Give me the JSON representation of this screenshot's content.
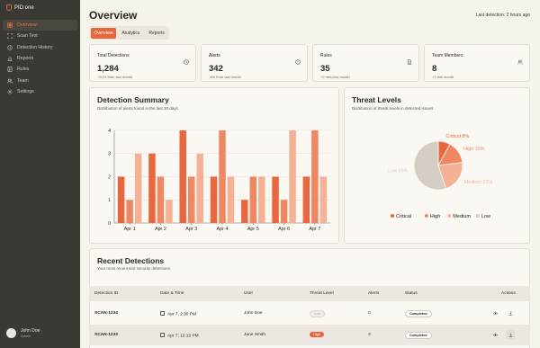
{
  "app": {
    "brand": "PID:one"
  },
  "sidebar": {
    "items": [
      {
        "label": "Overview",
        "icon": "dashboard-icon",
        "active": true
      },
      {
        "label": "Scan Text",
        "icon": "scan-icon",
        "active": false
      },
      {
        "label": "Detection History",
        "icon": "history-icon",
        "active": false
      },
      {
        "label": "Reports",
        "icon": "bar-chart-icon",
        "active": false
      },
      {
        "label": "Rules",
        "icon": "list-icon",
        "active": false
      },
      {
        "label": "Team",
        "icon": "team-icon",
        "active": false
      },
      {
        "label": "Settings",
        "icon": "gear-icon",
        "active": false
      }
    ],
    "user": {
      "name": "John Doe",
      "role": "Admin"
    }
  },
  "header": {
    "title": "Overview",
    "last_detection": "Last detection: 2 hours ago",
    "tabs": [
      "Overview",
      "Analytics",
      "Reports"
    ],
    "active_tab": "Overview"
  },
  "stats": [
    {
      "label": "Total Detections",
      "value": "1,284",
      "sub": "+10% from last month",
      "icon": "clock-icon"
    },
    {
      "label": "Alerts",
      "value": "342",
      "sub": "-4% from last month",
      "icon": "alert-icon"
    },
    {
      "label": "Rules",
      "value": "35",
      "sub": "+2 new this month",
      "icon": "document-icon"
    },
    {
      "label": "Team Members",
      "value": "8",
      "sub": "+1 this month",
      "icon": "users-icon"
    }
  ],
  "detection_summary": {
    "title": "Detection Summary",
    "subtitle": "Distribution of alerts found in the last 30 days"
  },
  "threat_levels": {
    "title": "Threat Levels",
    "subtitle": "Distribution of threat levels in detected issues"
  },
  "colors": {
    "critical": "#e8673f",
    "high": "#ef8763",
    "medium": "#f4b195",
    "low": "#d3cdc3",
    "accent": "#e8673f"
  },
  "chart_data": [
    {
      "type": "bar",
      "categories": [
        "Apr 1",
        "Apr 2",
        "Apr 3",
        "Apr 4",
        "Apr 5",
        "Apr 6",
        "Apr 7"
      ],
      "series": [
        {
          "values": [
            2,
            3,
            4,
            2,
            1,
            2,
            2
          ]
        },
        {
          "values": [
            1,
            2,
            2,
            4,
            2,
            1,
            4
          ]
        },
        {
          "values": [
            3,
            1,
            3,
            2,
            2,
            4,
            2
          ]
        }
      ],
      "ylim": [
        0,
        4
      ],
      "yticks": [
        0,
        1,
        2,
        3,
        4
      ],
      "grid": true
    },
    {
      "type": "pie",
      "labels": [
        "Critical",
        "High",
        "Medium",
        "Low"
      ],
      "slice_labels": [
        "Critical 8%",
        "High 15%",
        "Medium 22%",
        "Low 55%"
      ],
      "values": [
        8,
        15,
        22,
        55
      ],
      "legend": "bottom"
    }
  ],
  "recent": {
    "title": "Recent Detections",
    "subtitle": "Your most recent text security detections",
    "columns": [
      "Detection ID",
      "Date & Time",
      "User",
      "Threat Level",
      "Alerts",
      "Status",
      "Actions"
    ],
    "rows": [
      {
        "id": "SCAN-1234",
        "date": "Apr 7, 2:30 PM",
        "user": "John Doe",
        "threat": "Low",
        "alerts": "0",
        "status": "Completed"
      },
      {
        "id": "SCAN-1233",
        "date": "Apr 7, 12:15 PM",
        "user": "Jane Smith",
        "threat": "High",
        "alerts": "3",
        "status": "Completed"
      }
    ]
  }
}
